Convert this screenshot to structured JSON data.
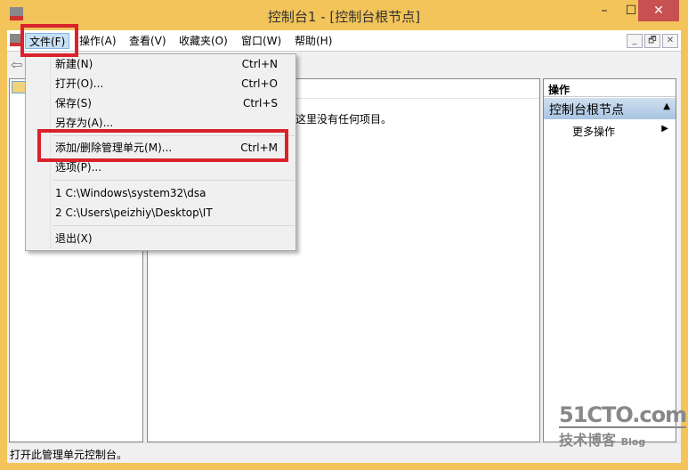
{
  "window": {
    "title": "控制台1 - [控制台根节点]",
    "minimize": "–",
    "maximize": "☐",
    "close": "✕",
    "close_color": "#c75050"
  },
  "menubar": {
    "items": [
      "文件(F)",
      "操作(A)",
      "查看(V)",
      "收藏夹(O)",
      "窗口(W)",
      "帮助(H)"
    ],
    "mdi": [
      "_",
      "🗗",
      "✕"
    ]
  },
  "file_menu": {
    "items": [
      {
        "label": "新建(N)",
        "shortcut": "Ctrl+N"
      },
      {
        "label": "打开(O)...",
        "shortcut": "Ctrl+O"
      },
      {
        "label": "保存(S)",
        "shortcut": "Ctrl+S"
      },
      {
        "label": "另存为(A)...",
        "shortcut": ""
      },
      {
        "label": "添加/删除管理单元(M)...",
        "shortcut": "Ctrl+M"
      },
      {
        "label": "选项(P)...",
        "shortcut": ""
      },
      {
        "label": "1 C:\\Windows\\system32\\dsa",
        "shortcut": ""
      },
      {
        "label": "2 C:\\Users\\peizhiy\\Desktop\\IT",
        "shortcut": ""
      },
      {
        "label": "退出(X)",
        "shortcut": ""
      }
    ]
  },
  "center": {
    "empty_text": "这里没有任何项目。"
  },
  "actions": {
    "header": "操作",
    "section": "控制台根节点",
    "more": "更多操作"
  },
  "status": {
    "text": "打开此管理单元控制台。"
  },
  "watermark": {
    "line1": "51CTO.com",
    "line2": "技术博客",
    "line3": "Blog"
  },
  "highlight_color": "#d9222b"
}
